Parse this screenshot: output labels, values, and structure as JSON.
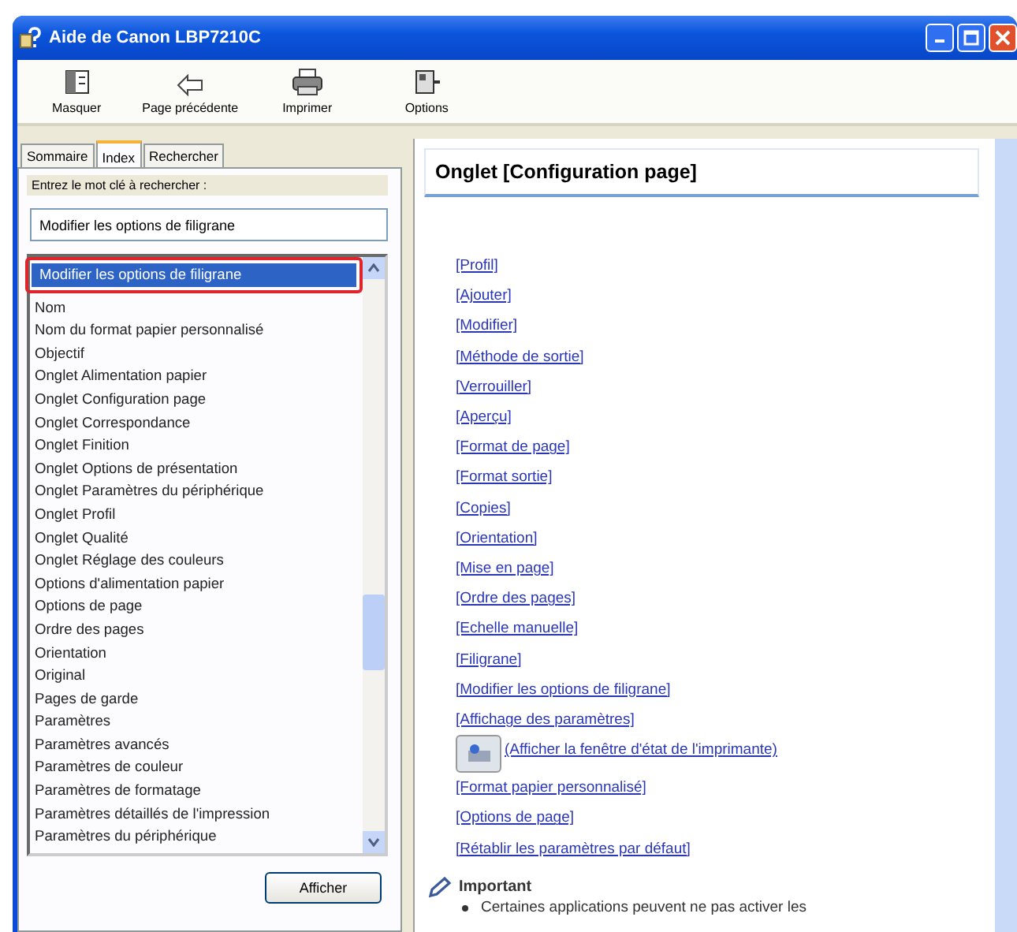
{
  "window": {
    "title": "Aide de Canon LBP7210C"
  },
  "toolbar": [
    {
      "label": "Masquer",
      "kind": "hide"
    },
    {
      "label": "Page précédente",
      "kind": "back"
    },
    {
      "label": "Imprimer",
      "kind": "print"
    },
    {
      "label": "Options",
      "kind": "options"
    }
  ],
  "tabs": [
    {
      "label": "Sommaire",
      "selected": false
    },
    {
      "label": "Index",
      "selected": true
    },
    {
      "label": "Rechercher",
      "selected": false
    }
  ],
  "index": {
    "prompt": "Entrez le mot clé à rechercher :",
    "search_value": "Modifier les options de filigrane",
    "button": "Afficher",
    "items": [
      {
        "label": "Modifier les options de filigrane",
        "selected": true,
        "outlined": true
      },
      {
        "label": "Nom",
        "selected": false,
        "outlined": false
      },
      {
        "label": "Nom du format papier personnalisé",
        "selected": false,
        "outlined": false
      },
      {
        "label": "Objectif",
        "selected": false,
        "outlined": false
      },
      {
        "label": "Onglet Alimentation papier",
        "selected": false,
        "outlined": false
      },
      {
        "label": "Onglet Configuration page",
        "selected": false,
        "outlined": false
      },
      {
        "label": "Onglet Correspondance",
        "selected": false,
        "outlined": false
      },
      {
        "label": "Onglet Finition",
        "selected": false,
        "outlined": false
      },
      {
        "label": "Onglet Options de présentation",
        "selected": false,
        "outlined": false
      },
      {
        "label": "Onglet Paramètres du périphérique",
        "selected": false,
        "outlined": false
      },
      {
        "label": "Onglet Profil",
        "selected": false,
        "outlined": false
      },
      {
        "label": "Onglet Qualité",
        "selected": false,
        "outlined": false
      },
      {
        "label": "Onglet Réglage des couleurs",
        "selected": false,
        "outlined": false
      },
      {
        "label": "Options d'alimentation papier",
        "selected": false,
        "outlined": false
      },
      {
        "label": "Options de page",
        "selected": false,
        "outlined": false
      },
      {
        "label": "Ordre des pages",
        "selected": false,
        "outlined": false
      },
      {
        "label": "Orientation",
        "selected": false,
        "outlined": false
      },
      {
        "label": "Original",
        "selected": false,
        "outlined": false
      },
      {
        "label": "Pages de garde",
        "selected": false,
        "outlined": false
      },
      {
        "label": "Paramètres",
        "selected": false,
        "outlined": false
      },
      {
        "label": "Paramètres avancés",
        "selected": false,
        "outlined": false
      },
      {
        "label": "Paramètres de couleur",
        "selected": false,
        "outlined": false
      },
      {
        "label": "Paramètres de formatage",
        "selected": false,
        "outlined": false
      },
      {
        "label": "Paramètres détaillés de l'impression",
        "selected": false,
        "outlined": false
      },
      {
        "label": "Paramètres du périphérique",
        "selected": false,
        "outlined": false
      }
    ]
  },
  "content": {
    "heading": "Onglet [Configuration page]",
    "links": [
      {
        "label": "[Profil]",
        "kind": "text"
      },
      {
        "label": "[Ajouter]",
        "kind": "text"
      },
      {
        "label": "[Modifier]",
        "kind": "text"
      },
      {
        "label": "[Méthode de sortie]",
        "kind": "text"
      },
      {
        "label": "[Verrouiller]",
        "kind": "text"
      },
      {
        "label": "[Aperçu]",
        "kind": "text"
      },
      {
        "label": "[Format de page]",
        "kind": "text"
      },
      {
        "label": "[Format sortie]",
        "kind": "text"
      },
      {
        "label": "[Copies]",
        "kind": "text"
      },
      {
        "label": "[Orientation]",
        "kind": "text"
      },
      {
        "label": "[Mise en page]",
        "kind": "text"
      },
      {
        "label": "[Ordre des pages]",
        "kind": "text"
      },
      {
        "label": "[Echelle manuelle]",
        "kind": "text"
      },
      {
        "label": "[Filigrane]",
        "kind": "text"
      },
      {
        "label": "[Modifier les options de filigrane]",
        "kind": "text"
      },
      {
        "label": "[Affichage des paramètres]",
        "kind": "text"
      },
      {
        "label": "(Afficher la fenêtre d'état de l'imprimante)",
        "kind": "icon"
      },
      {
        "label": "[Format papier personnalisé]",
        "kind": "text"
      },
      {
        "label": "[Options de page]",
        "kind": "text"
      },
      {
        "label": "[Rétablir les paramètres par défaut]",
        "kind": "text"
      }
    ],
    "note": {
      "title": "Important",
      "bullets": [
        "Certaines applications peuvent ne pas activer les"
      ]
    }
  }
}
